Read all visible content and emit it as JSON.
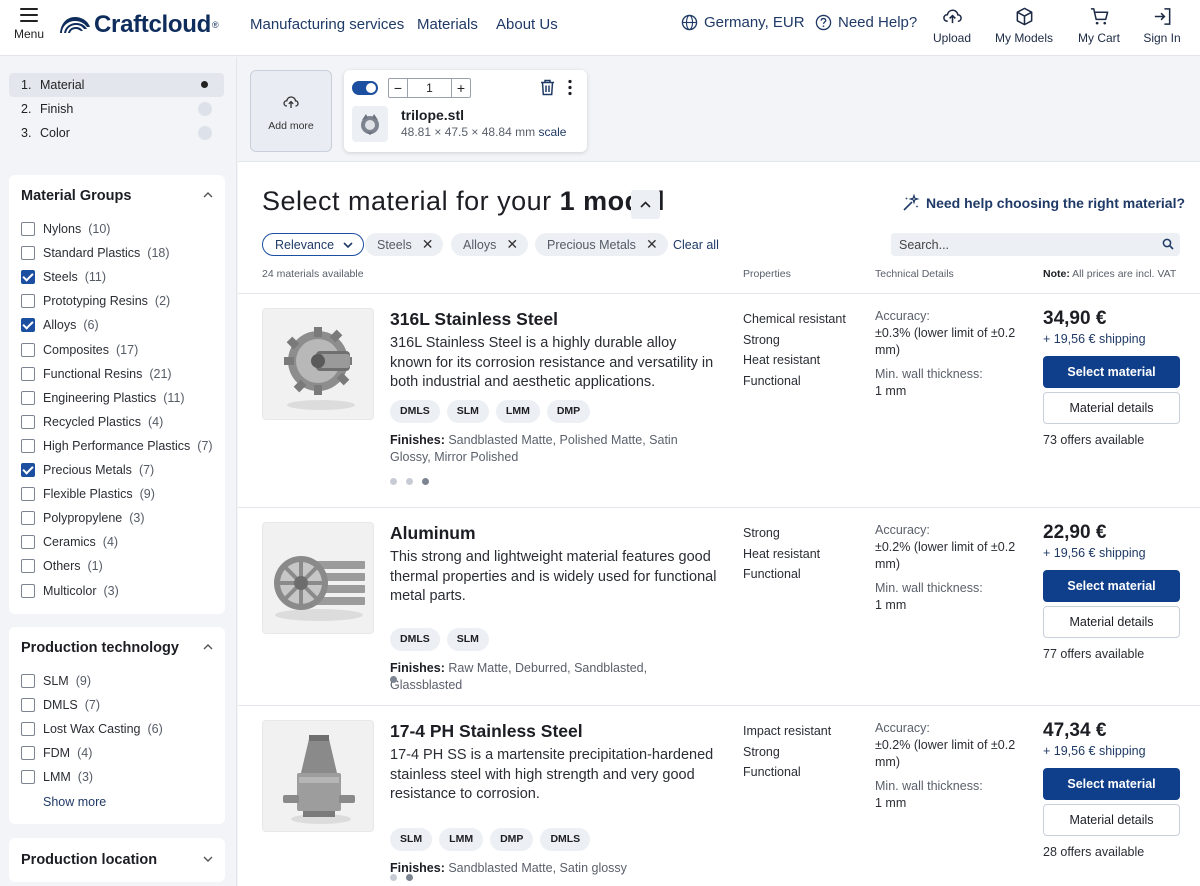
{
  "header": {
    "menu_label": "Menu",
    "logo_text": "Craftcloud",
    "logo_mark": "®",
    "nav": [
      "Manufacturing services",
      "Materials",
      "About Us"
    ],
    "region": "Germany, EUR",
    "help": "Need Help?",
    "icons": {
      "upload": "Upload",
      "models": "My Models",
      "cart": "My Cart",
      "signin": "Sign In"
    }
  },
  "steps": [
    {
      "num": "1.",
      "label": "Material",
      "active": true
    },
    {
      "num": "2.",
      "label": "Finish",
      "active": false
    },
    {
      "num": "3.",
      "label": "Color",
      "active": false
    }
  ],
  "material_groups": {
    "title": "Material Groups",
    "items": [
      {
        "label": "Nylons",
        "count": "(10)",
        "checked": false
      },
      {
        "label": "Standard Plastics",
        "count": "(18)",
        "checked": false
      },
      {
        "label": "Steels",
        "count": "(11)",
        "checked": true
      },
      {
        "label": "Prototyping Resins",
        "count": "(2)",
        "checked": false
      },
      {
        "label": "Alloys",
        "count": "(6)",
        "checked": true
      },
      {
        "label": "Composites",
        "count": "(17)",
        "checked": false
      },
      {
        "label": "Functional Resins",
        "count": "(21)",
        "checked": false
      },
      {
        "label": "Engineering Plastics",
        "count": "(11)",
        "checked": false
      },
      {
        "label": "Recycled Plastics",
        "count": "(4)",
        "checked": false
      },
      {
        "label": "High Performance Plastics",
        "count": "(7)",
        "checked": false
      },
      {
        "label": "Precious Metals",
        "count": "(7)",
        "checked": true
      },
      {
        "label": "Flexible Plastics",
        "count": "(9)",
        "checked": false
      },
      {
        "label": "Polypropylene",
        "count": "(3)",
        "checked": false
      },
      {
        "label": "Ceramics",
        "count": "(4)",
        "checked": false
      },
      {
        "label": "Others",
        "count": "(1)",
        "checked": false
      },
      {
        "label": "Multicolor",
        "count": "(3)",
        "checked": false
      }
    ]
  },
  "production_technology": {
    "title": "Production technology",
    "items": [
      {
        "label": "SLM",
        "count": "(9)",
        "checked": false
      },
      {
        "label": "DMLS",
        "count": "(7)",
        "checked": false
      },
      {
        "label": "Lost Wax Casting",
        "count": "(6)",
        "checked": false
      },
      {
        "label": "FDM",
        "count": "(4)",
        "checked": false
      },
      {
        "label": "LMM",
        "count": "(3)",
        "checked": false
      }
    ],
    "show_more": "Show more"
  },
  "production_location": {
    "title": "Production location"
  },
  "model_strip": {
    "add_more": "Add more",
    "quantity": "1",
    "minus": "−",
    "plus": "+",
    "filename": "trilope.stl",
    "dims": "48.81 × 47.5 × 48.84 mm",
    "scale": "scale"
  },
  "main": {
    "heading_prefix": "Select material for your",
    "heading_bold": "1 model",
    "help_choose": "Need help choosing the right material?",
    "sort_label": "Relevance",
    "filters": [
      "Steels",
      "Alloys",
      "Precious Metals"
    ],
    "clear_all": "Clear all",
    "search_placeholder": "Search...",
    "count": "24 materials available",
    "col_properties": "Properties",
    "col_technical": "Technical Details",
    "note_label": "Note:",
    "note_text": " All prices are incl. VAT"
  },
  "materials": [
    {
      "name": "316L Stainless Steel",
      "desc": "316L Stainless Steel is a highly durable alloy known for its corrosion resistance and versatility in both industrial and aesthetic applications.",
      "tags": [
        "DMLS",
        "SLM",
        "LMM",
        "DMP"
      ],
      "finishes_label": "Finishes:",
      "finishes": " Sandblasted Matte, Polished Matte, Satin Glossy, Mirror Polished",
      "props": [
        "Chemical resistant",
        "Strong",
        "Heat resistant",
        "Functional"
      ],
      "accuracy_label": "Accuracy:",
      "accuracy": "±0.3% (lower limit of ±0.2 mm)",
      "wall_label": "Min. wall thickness:",
      "wall": "1 mm",
      "price": "34,90 €",
      "shipping": "+ 19,56 € shipping",
      "select": "Select material",
      "details": "Material details",
      "offers": "73 offers available",
      "dots": 3
    },
    {
      "name": "Aluminum",
      "desc": "This strong and lightweight material features good thermal properties and is widely used for functional metal parts.",
      "tags": [
        "DMLS",
        "SLM"
      ],
      "finishes_label": "Finishes:",
      "finishes": " Raw Matte, Deburred, Sandblasted, Glassblasted",
      "props": [
        "Strong",
        "Heat resistant",
        "Functional"
      ],
      "accuracy_label": "Accuracy:",
      "accuracy": "±0.2% (lower limit of ±0.2 mm)",
      "wall_label": "Min. wall thickness:",
      "wall": "1 mm",
      "price": "22,90 €",
      "shipping": "+ 19,56 € shipping",
      "select": "Select material",
      "details": "Material details",
      "offers": "77 offers available",
      "dots": 1
    },
    {
      "name": "17-4 PH Stainless Steel",
      "desc": "17-4 PH SS is a martensite precipitation-hardened stainless steel with high strength and very good resistance to corrosion.",
      "tags": [
        "SLM",
        "LMM",
        "DMP",
        "DMLS"
      ],
      "finishes_label": "Finishes:",
      "finishes": " Sandblasted Matte, Satin glossy",
      "props": [
        "Impact resistant",
        "Strong",
        "Functional"
      ],
      "accuracy_label": "Accuracy:",
      "accuracy": "±0.2% (lower limit of ±0.2 mm)",
      "wall_label": "Min. wall thickness:",
      "wall": "1 mm",
      "price": "47,34 €",
      "shipping": "+ 19,56 € shipping",
      "select": "Select material",
      "details": "Material details",
      "offers": "28 offers available",
      "dots": 2
    }
  ]
}
